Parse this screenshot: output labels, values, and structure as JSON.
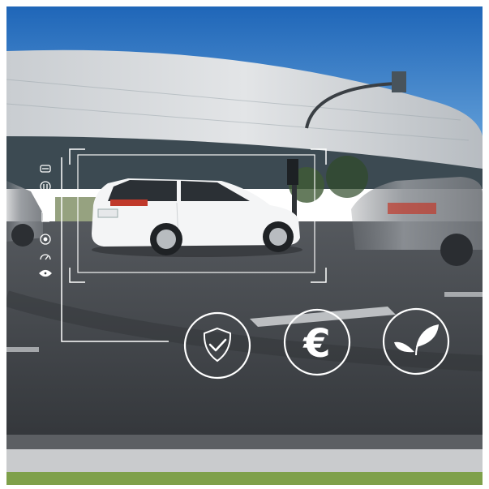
{
  "scene": {
    "description_icons": [
      "car-front-icon",
      "speed-limit-icon",
      "engine-icon",
      "angle-icon",
      "steering-wheel-icon",
      "gauge-icon",
      "eye-icon"
    ],
    "feature_icons": [
      "shield-check-icon",
      "euro-icon",
      "leaf-icon"
    ],
    "euro_symbol": "€"
  },
  "colors": {
    "sky_top": "#1f6fbf",
    "sky_bottom": "#5aa0dd",
    "road": "#3e4247",
    "overlay_line": "#ffffff"
  }
}
